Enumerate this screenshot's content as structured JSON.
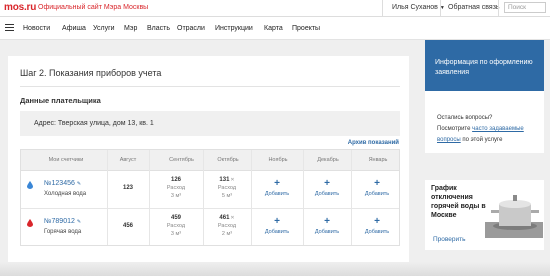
{
  "header": {
    "logo": "mos.ru",
    "site_title": "Официальный сайт Мэра Москвы",
    "user_name": "Илья Суханов",
    "feedback": "Обратная связь",
    "search_placeholder": "Поиск"
  },
  "nav": {
    "items": [
      "Новости",
      "Афиша",
      "Услуги",
      "Мэр",
      "Власть",
      "Отрасли",
      "Инструкции",
      "Карта",
      "Проекты"
    ]
  },
  "main": {
    "step_title": "Шаг 2. Показания приборов учета",
    "payer_label": "Данные плательщика",
    "address": "Адрес: Тверская улица, дом 13, кв. 1",
    "archive_link": "Архив показаний",
    "columns": [
      "Мои счетчики",
      "Август",
      "Сентябрь",
      "Октябрь",
      "Ноябрь",
      "Декабрь",
      "Январь"
    ],
    "rows": [
      {
        "meter": "№123456",
        "type": "Холодная вода",
        "aug": "123",
        "sep": "126",
        "sep_usage": "Расход",
        "sep_amount": "3 м³",
        "oct": "131",
        "oct_usage": "Расход",
        "oct_amount": "5 м³",
        "add_label": "Добавить"
      },
      {
        "meter": "№789012",
        "type": "Горячая вода",
        "aug": "456",
        "sep": "459",
        "sep_usage": "Расход",
        "sep_amount": "3 м³",
        "oct": "461",
        "oct_usage": "Расход",
        "oct_amount": "2 м³",
        "add_label": "Добавить"
      }
    ]
  },
  "sidebar": {
    "info_title": "Информация по оформлению заявления",
    "help_line1": "Остались вопросы?",
    "help_line2_prefix": "Посмотрите",
    "help_link": "часто задаваемые вопросы",
    "help_line3_suffix": "по этой услуге",
    "promo_title": "График отключения горячей воды в Москве",
    "promo_link": "Проверить"
  },
  "colors": {
    "brand_red": "#d9262b",
    "link_blue": "#2e6aa5",
    "panel_blue": "#2e6aa5",
    "cold_drop": "#3a86d6",
    "hot_drop": "#d9262b"
  }
}
